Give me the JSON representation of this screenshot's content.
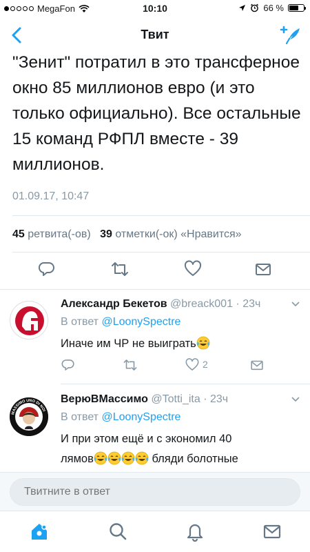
{
  "status_bar": {
    "carrier": "MegaFon",
    "time": "10:10",
    "battery": "66 %",
    "battery_level": 0.66
  },
  "nav": {
    "title": "Твит"
  },
  "tweet": {
    "text": "\"Зенит\" потратил в это трансферное окно 85 миллионов евро (и это только официально). Все остальные 15 команд РФПЛ вместе - 39 миллионов.",
    "date": "01.09.17, 10:47",
    "retweet_count": "45",
    "retweet_label": "ретвита(-ов)",
    "like_count": "39",
    "like_label": "отметки(-ок) «Нравится»"
  },
  "replies": [
    {
      "name": "Александр Бекетов",
      "handle": "@breack001",
      "time": "23ч",
      "in_reply_prefix": "В ответ",
      "in_reply_to": "@LoonySpectre",
      "text": "Иначе им ЧР не выиграть",
      "emoji_count": 1,
      "like_count": "2"
    },
    {
      "name": "ВерюВМассимо",
      "handle": "@Totti_ita",
      "time": "23ч",
      "in_reply_prefix": "В ответ",
      "in_reply_to": "@LoonySpectre",
      "text_line1": "И при этом ещё и с экономил 40",
      "text_line2_a": "лямов",
      "text_line2_b": " бляди болотные",
      "emoji_count": 4,
      "avatar_text": "MASSIMO UNO DI NOI"
    }
  ],
  "composer": {
    "placeholder": "Твитните в ответ"
  },
  "colors": {
    "accent": "#1da1f2",
    "secondary_text": "#8899a6",
    "icon_gray": "#657786"
  }
}
